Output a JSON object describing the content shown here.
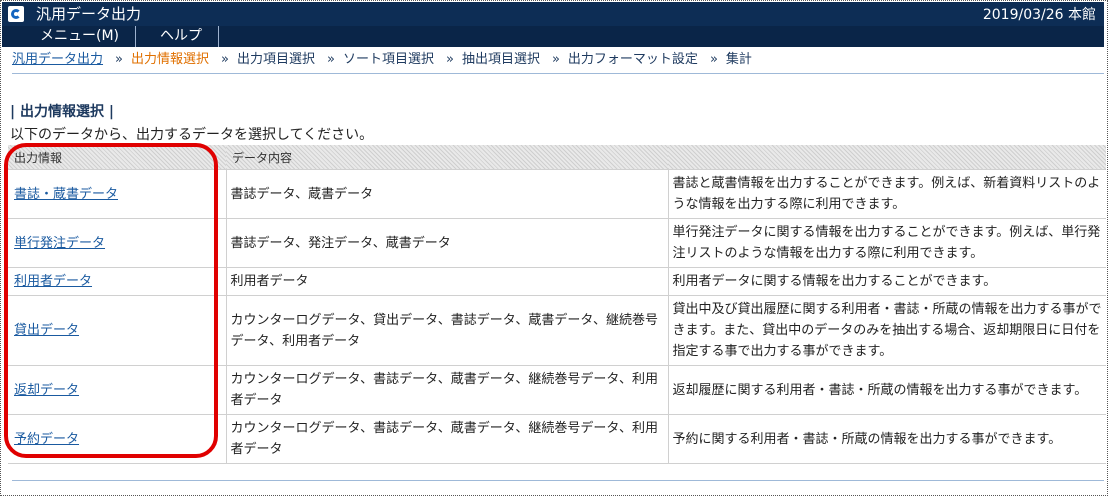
{
  "window": {
    "title": "汎用データ出力",
    "date_location": "2019/03/26 本館",
    "icon": "app-logo-icon"
  },
  "menu": {
    "items": [
      {
        "label": "メニュー(M)"
      },
      {
        "label": "ヘルプ"
      }
    ]
  },
  "breadcrumb": {
    "items": [
      "汎用データ出力",
      "出力情報選択",
      "出力項目選択",
      "ソート項目選択",
      "抽出項目選択",
      "出力フォーマット設定",
      "集計"
    ],
    "separator": "»"
  },
  "section": {
    "title": "| 出力情報選択 |",
    "instruction": "以下のデータから、出力するデータを選択してください。"
  },
  "table": {
    "headers": [
      "出力情報",
      "データ内容",
      ""
    ],
    "rows": [
      {
        "name": "書誌・蔵書データ",
        "content": "書誌データ、蔵書データ",
        "description": "書誌と蔵書情報を出力することができます。例えば、新着資料リストのような情報を出力する際に利用できます。"
      },
      {
        "name": "単行発注データ",
        "content": "書誌データ、発注データ、蔵書データ",
        "description": "単行発注データに関する情報を出力することができます。例えば、単行発注リストのような情報を出力する際に利用できます。"
      },
      {
        "name": "利用者データ",
        "content": "利用者データ",
        "description": "利用者データに関する情報を出力することができます。"
      },
      {
        "name": "貸出データ",
        "content": "カウンターログデータ、貸出データ、書誌データ、蔵書データ、継続巻号データ、利用者データ",
        "description": "貸出中及び貸出履歴に関する利用者・書誌・所蔵の情報を出力する事ができます。また、貸出中のデータのみを抽出する場合、返却期限日に日付を指定する事で出力する事ができます。"
      },
      {
        "name": "返却データ",
        "content": "カウンターログデータ、書誌データ、蔵書データ、継続巻号データ、利用者データ",
        "description": "返却履歴に関する利用者・書誌・所蔵の情報を出力する事ができます。"
      },
      {
        "name": "予約データ",
        "content": "カウンターログデータ、書誌データ、蔵書データ、継続巻号データ、利用者データ",
        "description": "予約に関する利用者・書誌・所蔵の情報を出力する事ができます。"
      }
    ]
  },
  "colors": {
    "titlebar": "#0d2d55",
    "menubar": "#0a2548",
    "link": "#1a5aa0",
    "current_crumb": "#e07000",
    "highlight": "#e00000"
  }
}
